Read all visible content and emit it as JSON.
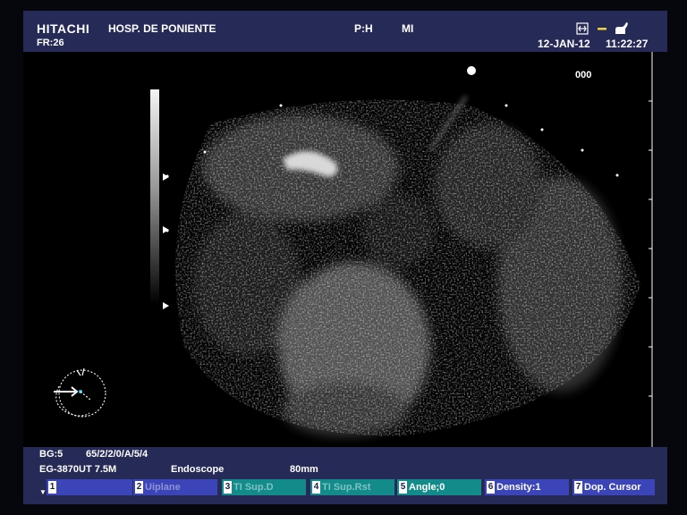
{
  "header": {
    "brand": "HITACHI",
    "hospital": "HOSP. DE PONIENTE",
    "frame_rate": "FR:26",
    "ph_label": "P:H",
    "mi_label": "MI",
    "date": "12-JAN-12",
    "time": "11:22:27",
    "icons": [
      "frame-icon",
      "dash-icon",
      "hand-icon"
    ]
  },
  "image": {
    "zoom_code": "000",
    "gray_scale": "grayscale-bar",
    "probe_icon": "endoscope-orientation-icon"
  },
  "footer": {
    "bg": "BG:5",
    "params": "65/2/2/0/A/5/4",
    "probe": "EG-3870UT 7.5M",
    "mode": "Endoscope",
    "depth": "80mm",
    "marker": "▼",
    "softkeys": [
      {
        "num": "1",
        "label": "",
        "style": "blue"
      },
      {
        "num": "2",
        "label": "Uiplane",
        "style": "blue"
      },
      {
        "num": "3",
        "label": "TI Sup.D",
        "style": "teal"
      },
      {
        "num": "4",
        "label": "TI Sup.Rst",
        "style": "teal"
      },
      {
        "num": "5",
        "label": "Angle;0",
        "style": "teal"
      },
      {
        "num": "6",
        "label": "Density:1",
        "style": "blue"
      },
      {
        "num": "7",
        "label": "Dop. Cursor",
        "style": "blue"
      }
    ]
  },
  "colors": {
    "panel": "#252a57",
    "key_blue": "#3b45b8",
    "key_teal": "#138b8b",
    "accent": "#f0d040"
  }
}
